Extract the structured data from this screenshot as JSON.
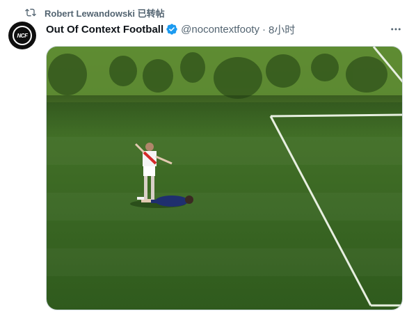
{
  "social_context": {
    "icon": "repost-icon",
    "text": "Robert Lewandowski 已转帖"
  },
  "tweet": {
    "avatar_text": "NCF",
    "display_name": "Out Of Context Football",
    "verified_icon": "verified-badge-icon",
    "handle": "@nocontextfooty",
    "separator": "·",
    "time": "8小时",
    "more_icon": "more-options-icon"
  },
  "media": {
    "description_icon": "football-video-thumbnail"
  },
  "colors": {
    "text_secondary": "#536471",
    "text_primary": "#0f1419",
    "verified_blue": "#1d9bf0",
    "pitch_green": "#4a7a2a"
  }
}
